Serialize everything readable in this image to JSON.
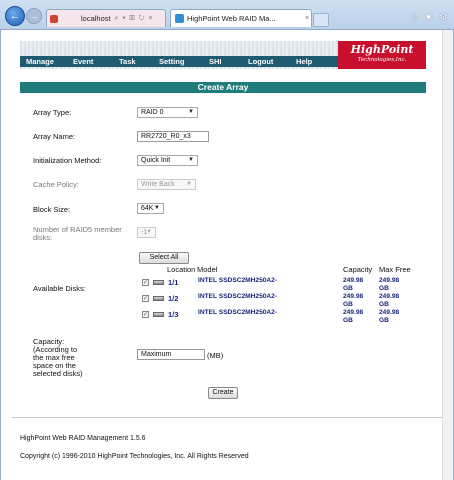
{
  "browser": {
    "address": "localhost",
    "address_tools": "⌕ ▾ ☒ ↻ ×",
    "tab_title": "HighPoint Web RAID Ma...",
    "tab_close": "×"
  },
  "menu": [
    "Manage",
    "Event",
    "Task",
    "Setting",
    "SHI",
    "Logout",
    "Help"
  ],
  "logo": {
    "main": "HighPoint",
    "sub": "Technologies,Inc."
  },
  "page_title": "Create Array",
  "form": {
    "array_type": {
      "label": "Array Type:",
      "value": "RAID 0"
    },
    "array_name": {
      "label": "Array Name:",
      "value": "RR2720_R0_x3"
    },
    "init_method": {
      "label": "Initialization Method:",
      "value": "Quick Init"
    },
    "cache_policy": {
      "label": "Cache Policy:",
      "value": "Write Back"
    },
    "block_size": {
      "label": "Block Size:",
      "value": "64K"
    },
    "raid5_members": {
      "label_line1": "Number of RAID5 member",
      "label_line2": "disks:",
      "value": "-1"
    },
    "available_disks": {
      "label": "Available Disks:",
      "select_all": "Select All",
      "headers": {
        "location": "Location",
        "model": "Model",
        "capacity": "Capacity",
        "max_free": "Max Free"
      },
      "disks": [
        {
          "checked": "✓",
          "location": "1/1",
          "model": "INTEL SSDSC2MH250A2-",
          "capacity_value": "249.98",
          "capacity_unit": "GB",
          "max_free_value": "249.98",
          "max_free_unit": "GB"
        },
        {
          "checked": "✓",
          "location": "1/2",
          "model": "INTEL SSDSC2MH250A2-",
          "capacity_value": "249.98",
          "capacity_unit": "GB",
          "max_free_value": "249.98",
          "max_free_unit": "GB"
        },
        {
          "checked": "✓",
          "location": "1/3",
          "model": "INTEL SSDSC2MH250A2-",
          "capacity_value": "249.98",
          "capacity_unit": "GB",
          "max_free_value": "249.98",
          "max_free_unit": "GB"
        }
      ]
    },
    "capacity": {
      "label_lines": [
        "Capacity:",
        "(According to",
        "the max free",
        "space on the",
        "selected disks)"
      ],
      "value": "Maximum",
      "unit": "(MB)"
    },
    "create_button": "Create"
  },
  "footer": {
    "product": "HighPoint Web RAID Management 1.5.6",
    "copyright": "Copyright (c) 1996-2010 HighPoint Technologies, Inc. All Rights Reserved"
  }
}
